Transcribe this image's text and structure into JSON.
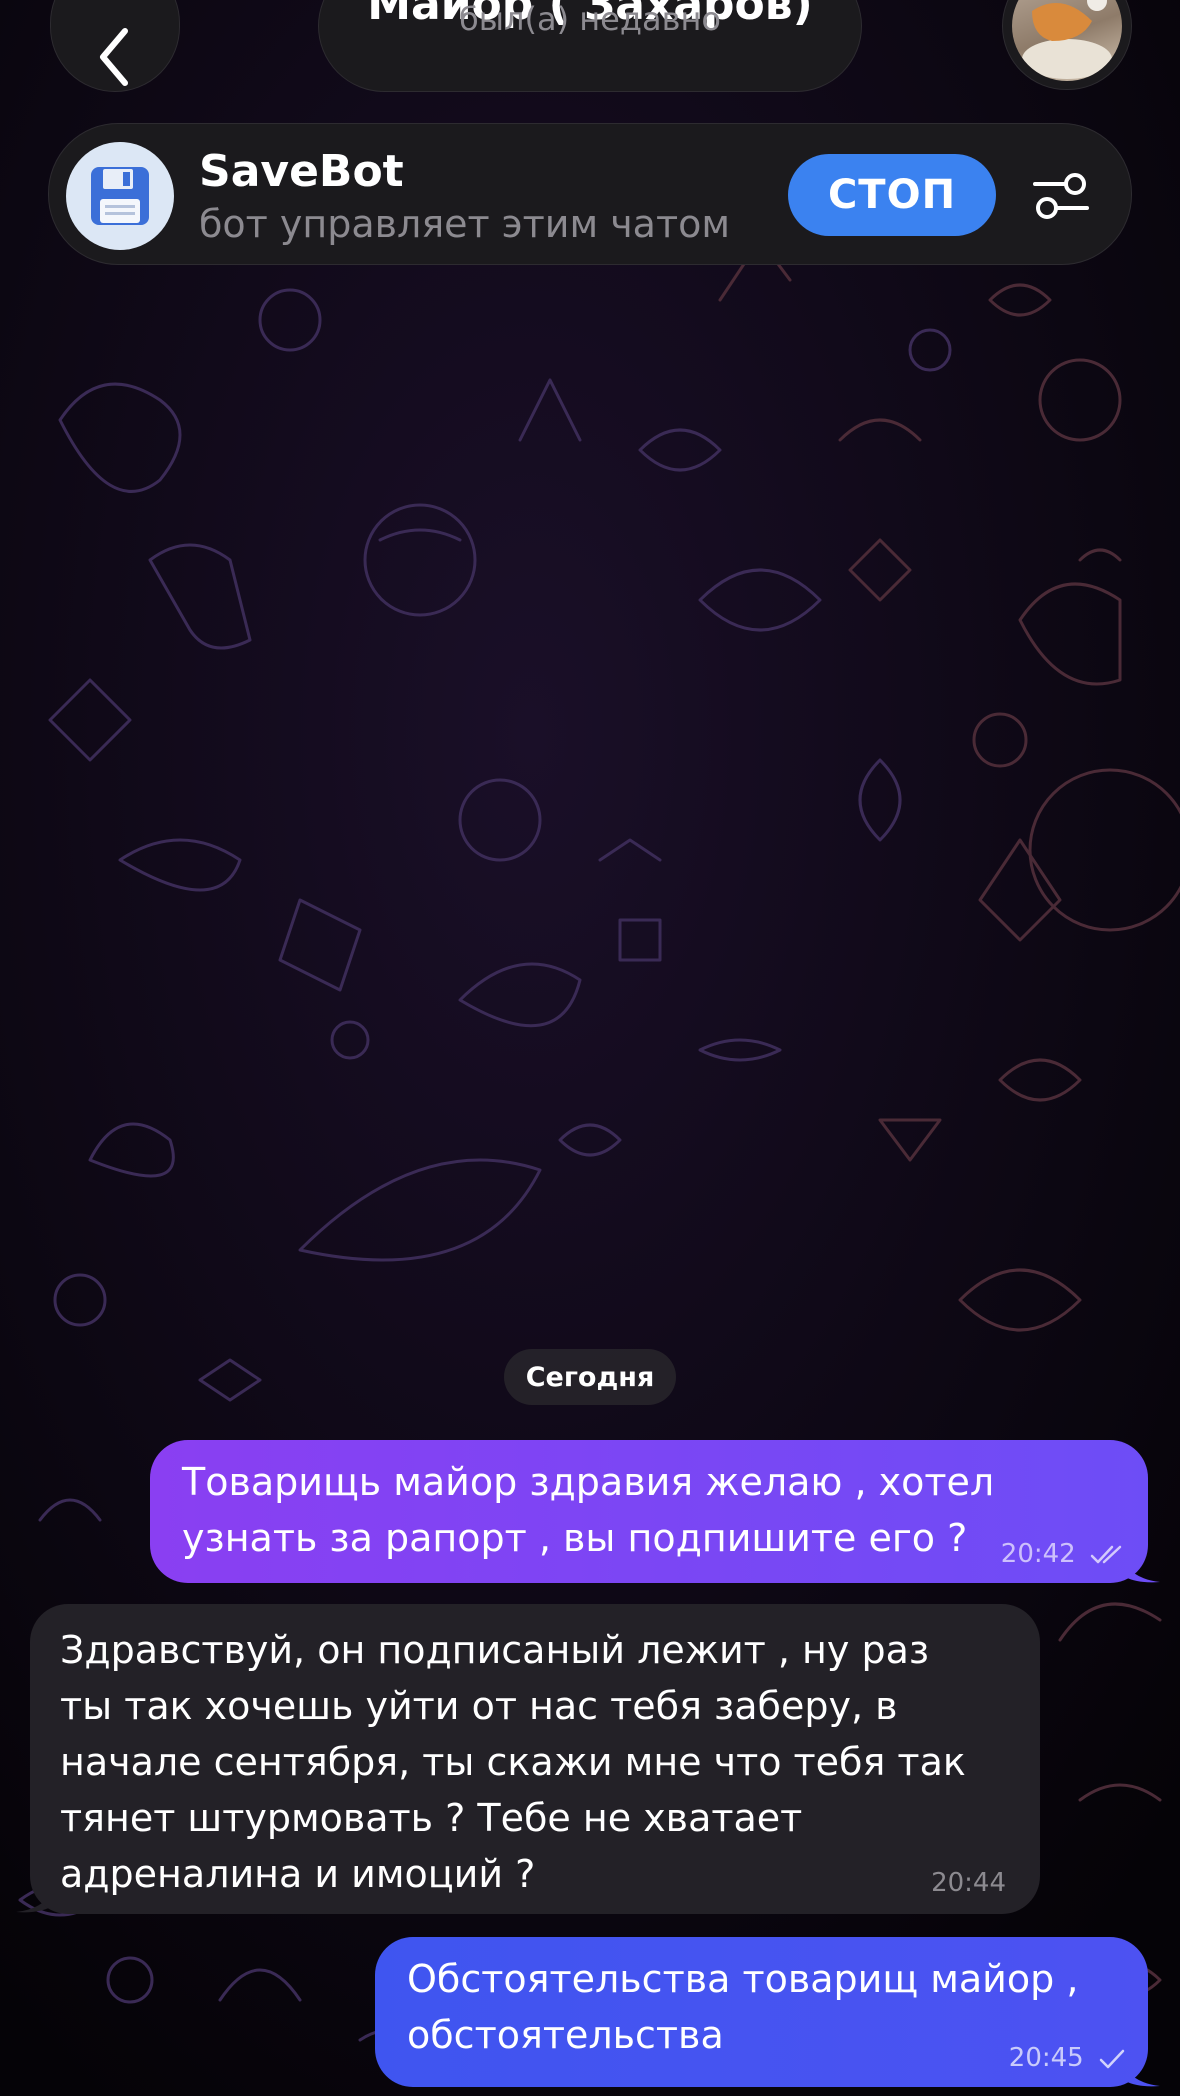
{
  "header": {
    "contact_name": "Майор ( Захаров)",
    "contact_status": "был(а) недавно",
    "back_icon": "chevron-left-icon"
  },
  "bot_panel": {
    "bot_name": "SaveBot",
    "subtitle": "бот управляет этим чатом",
    "stop_label": "СТОП",
    "bot_icon": "floppy-disk-icon",
    "settings_icon": "sliders-icon"
  },
  "date_chip": "Сегодня",
  "messages": [
    {
      "direction": "outgoing",
      "text": "Товарищь майор здравия желаю , хотел\nузнать за рапорт , вы подпишите его ?",
      "time": "20:42",
      "status": "read"
    },
    {
      "direction": "incoming",
      "text": "Здравствуй, он подписаный лежит , ну раз\nты так хочешь уйти от нас тебя заберу, в\nначале сентября, ты скажи мне что тебя так\nтянет штурмовать ? Тебе не хватает\nадреналина и имоций ?",
      "time": "20:44"
    },
    {
      "direction": "outgoing",
      "text": "Обстоятельства товарищ майор ,\nобстоятельства",
      "time": "20:45",
      "status": "sent"
    }
  ],
  "colors": {
    "background": "#050307",
    "outgoing_bubble_1": "#7a45f4",
    "outgoing_bubble_2": "#4254f0",
    "incoming_bubble": "#232127",
    "stop_button": "#3b82f0",
    "secondary_text": "#8c8a90"
  }
}
